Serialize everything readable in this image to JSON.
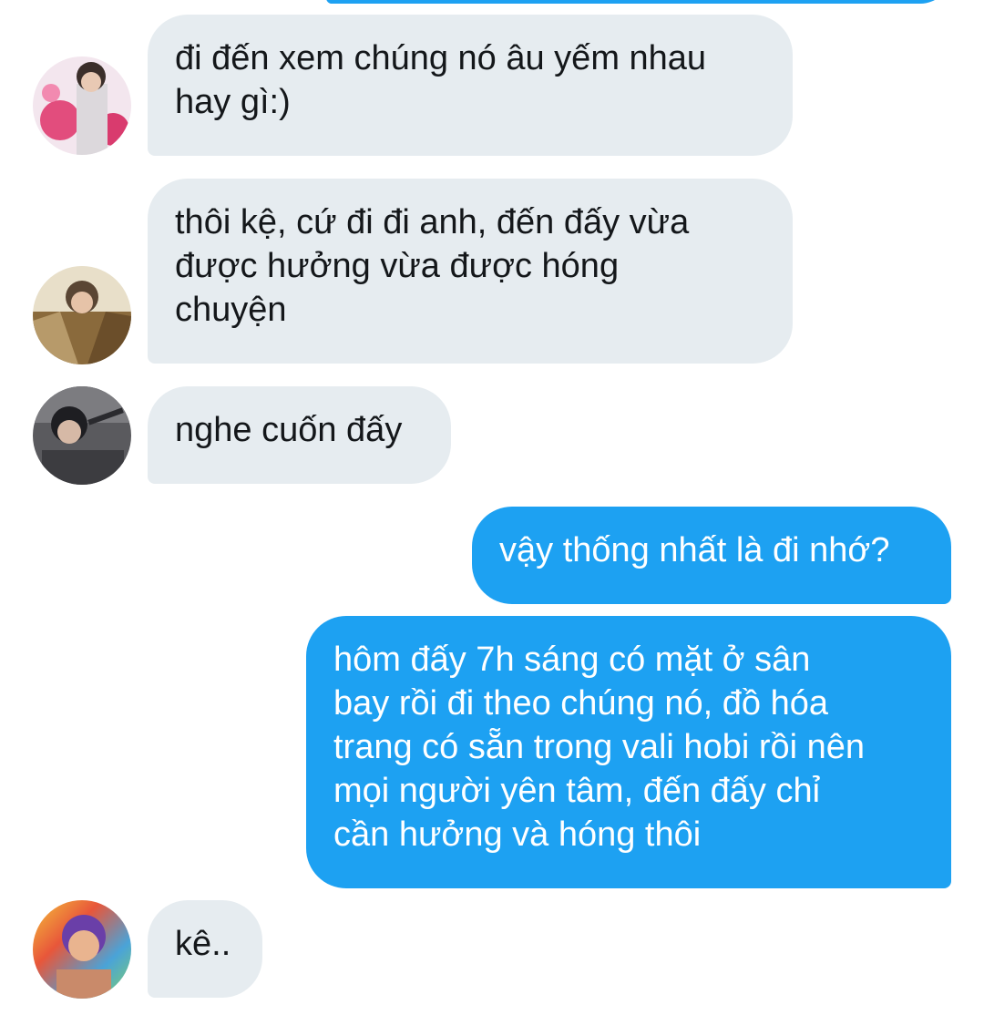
{
  "conversation": {
    "messages": [
      {
        "sender": "other",
        "avatar": "avatar-1-icon",
        "text": "đi đến xem chúng nó âu yếm nhau\nhay gì:)"
      },
      {
        "sender": "other",
        "avatar": "avatar-2-icon",
        "text": "thôi kệ, cứ đi đi anh, đến đấy vừa\nđược hưởng vừa được hóng\nchuyện"
      },
      {
        "sender": "other",
        "avatar": "avatar-3-icon",
        "text": "nghe cuốn đấy"
      },
      {
        "sender": "self",
        "text": "vậy thống nhất là đi nhớ?"
      },
      {
        "sender": "self",
        "text": "hôm đấy 7h sáng có mặt ở sân\nbay rồi đi theo chúng nó, đồ hóa\ntrang có sẵn trong vali hobi rồi nên\nmọi người yên tâm, đến đấy chỉ\ncần hưởng và hóng thôi"
      },
      {
        "sender": "other",
        "avatar": "avatar-4-icon",
        "text": "kê.."
      }
    ]
  },
  "colors": {
    "incoming_bubble": "#e6ecf0",
    "outgoing_bubble": "#1da1f2",
    "incoming_text": "#14171a",
    "outgoing_text": "#ffffff"
  }
}
